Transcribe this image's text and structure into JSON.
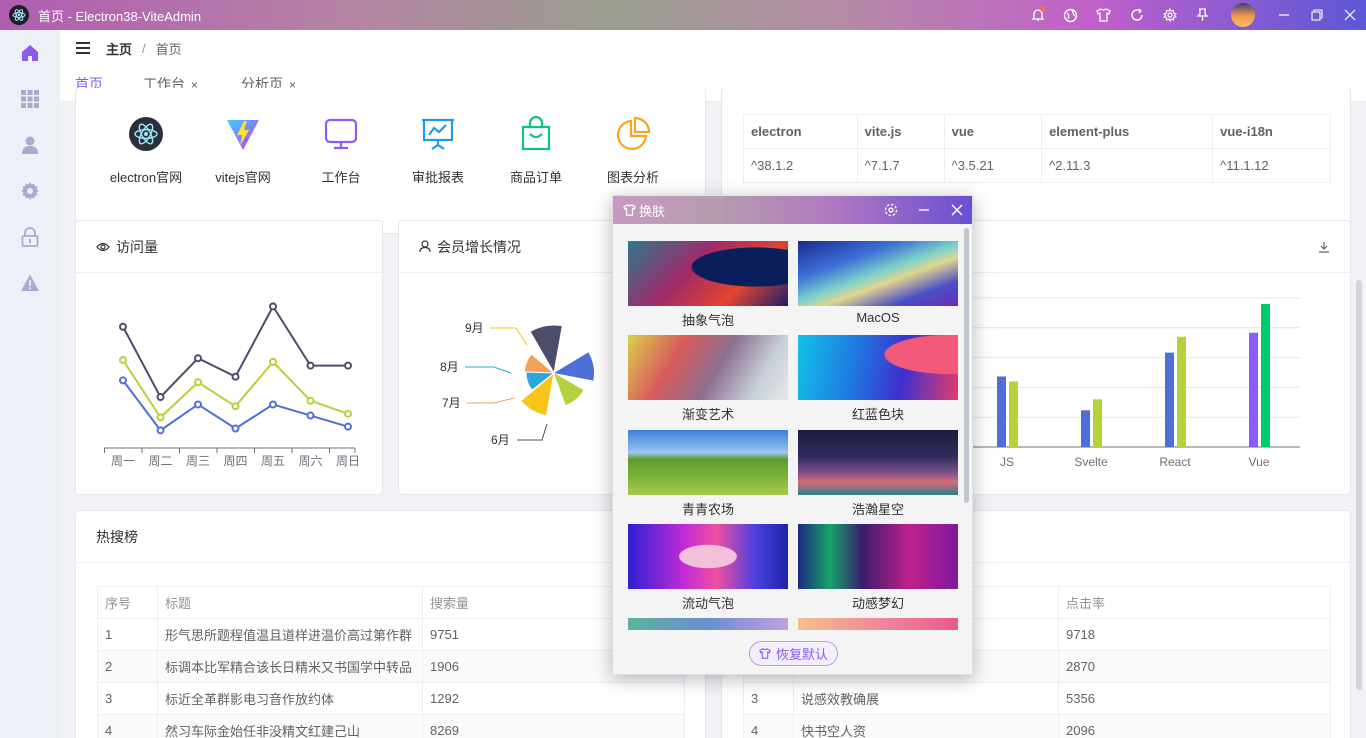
{
  "window": {
    "title": "首页 - Electron38-ViteAdmin"
  },
  "breadcrumb": {
    "root": "主页",
    "sep": "/",
    "current": "首页"
  },
  "tabs": [
    {
      "label": "首页",
      "close": ""
    },
    {
      "label": "工作台",
      "close": "×"
    },
    {
      "label": "分析页",
      "close": "×"
    }
  ],
  "shortcuts": [
    {
      "label": "electron官网",
      "icon": "electron-icon"
    },
    {
      "label": "vitejs官网",
      "icon": "vite-icon"
    },
    {
      "label": "工作台",
      "icon": "monitor-icon"
    },
    {
      "label": "审批报表",
      "icon": "presentation-chart-icon"
    },
    {
      "label": "商品订单",
      "icon": "shopping-bag-icon"
    },
    {
      "label": "图表分析",
      "icon": "pie-chart-icon"
    }
  ],
  "deps": {
    "headers": [
      "electron",
      "vite.js",
      "vue",
      "element-plus",
      "vue-i18n"
    ],
    "values": [
      "^38.1.2",
      "^7.1.7",
      "^3.5.21",
      "^2.11.3",
      "^11.1.12"
    ]
  },
  "visits_card": {
    "title": "访问量"
  },
  "members_card": {
    "title": "会员增长情况"
  },
  "colors": {
    "accent": "#8a5cf0",
    "series1": "#4b4d6b",
    "series2": "#b5d13b",
    "series3": "#4f6fd8",
    "green": "#00c96b",
    "purple": "#8b5cf6"
  },
  "chart_data": [
    {
      "type": "line",
      "categories": [
        "周一",
        "周二",
        "周三",
        "周四",
        "周五",
        "周六",
        "周日"
      ],
      "series": [
        {
          "values": [
            90,
            52,
            73,
            63,
            101,
            69,
            69
          ]
        },
        {
          "values": [
            72,
            41,
            60,
            47,
            71,
            50,
            43
          ]
        },
        {
          "values": [
            61,
            34,
            48,
            35,
            48,
            42,
            36
          ]
        }
      ]
    },
    {
      "type": "pie",
      "categories": [
        "6月",
        "7月",
        "8月",
        "9月"
      ],
      "series": [
        {
          "values": [
            22,
            10,
            9,
            19
          ]
        }
      ]
    },
    {
      "type": "bar",
      "categories": [
        "JS",
        "Svelte",
        "React",
        "Vue"
      ],
      "series": [
        {
          "values": [
            71,
            37,
            95,
            115
          ]
        },
        {
          "values": [
            66,
            48,
            111,
            144
          ]
        },
        {
          "values": [
            0,
            0,
            0,
            144
          ]
        }
      ]
    }
  ],
  "hot": {
    "title": "热搜榜",
    "headers": [
      "序号",
      "标题",
      "搜索量"
    ],
    "rows": [
      [
        "1",
        "形气思所题程值温且道样进温价高过第作群",
        "9751"
      ],
      [
        "2",
        "标调本比军精合该长日精米又书国学中转品",
        "1906"
      ],
      [
        "3",
        "标近全革群影电习音作放约体",
        "1292"
      ],
      [
        "4",
        "然习车际金始任非没精文红建己山",
        "8269"
      ]
    ]
  },
  "right_table": {
    "header_last": "点击率",
    "rows": [
      [
        "",
        "",
        "9718"
      ],
      [
        "",
        "",
        "2870"
      ],
      [
        "3",
        "说感效教确展",
        "5356"
      ],
      [
        "4",
        "快书空人资",
        "2096"
      ]
    ]
  },
  "skin": {
    "title": "换肤",
    "restore_label": "恢复默认",
    "items": [
      {
        "label": "抽象气泡"
      },
      {
        "label": "MacOS"
      },
      {
        "label": "渐变艺术"
      },
      {
        "label": "红蓝色块"
      },
      {
        "label": "青青农场"
      },
      {
        "label": "浩瀚星空"
      },
      {
        "label": "流动气泡"
      },
      {
        "label": "动感梦幻"
      }
    ]
  }
}
